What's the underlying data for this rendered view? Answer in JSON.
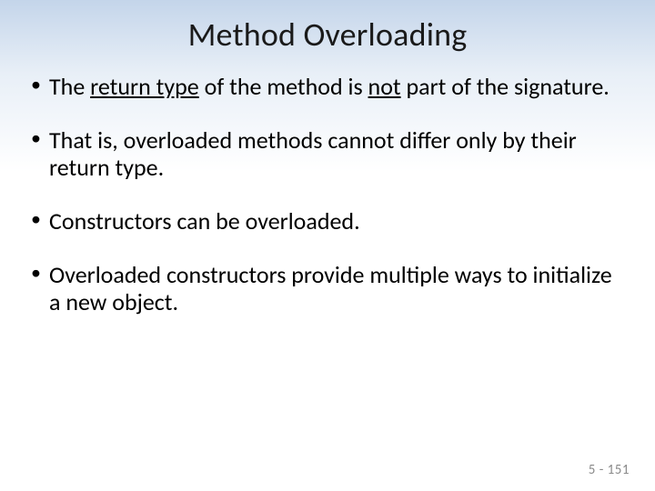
{
  "title": "Method Overloading",
  "bullets": {
    "b1": {
      "pre": "The ",
      "u1": "return type",
      "mid": " of the method is ",
      "u2": "not",
      "post": " part of the signature."
    },
    "b2": "That is, overloaded methods cannot differ only by their return type.",
    "b3": "Constructors can be overloaded.",
    "b4": "Overloaded constructors provide multiple ways to initialize a new object."
  },
  "footer": "5 - 151"
}
